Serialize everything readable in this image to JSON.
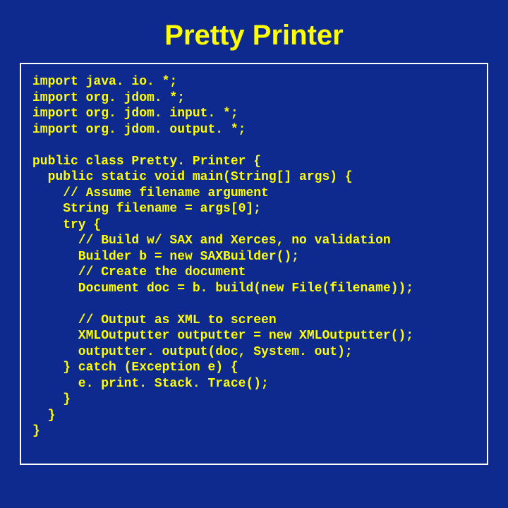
{
  "title": "Pretty Printer",
  "code": "import java. io. *;\nimport org. jdom. *;\nimport org. jdom. input. *;\nimport org. jdom. output. *;\n\npublic class Pretty. Printer {\n  public static void main(String[] args) {\n    // Assume filename argument\n    String filename = args[0];\n    try {\n      // Build w/ SAX and Xerces, no validation\n      Builder b = new SAXBuilder();\n      // Create the document\n      Document doc = b. build(new File(filename));\n\n      // Output as XML to screen\n      XMLOutputter outputter = new XMLOutputter();\n      outputter. output(doc, System. out);\n    } catch (Exception e) {\n      e. print. Stack. Trace();\n    }\n  }\n}"
}
